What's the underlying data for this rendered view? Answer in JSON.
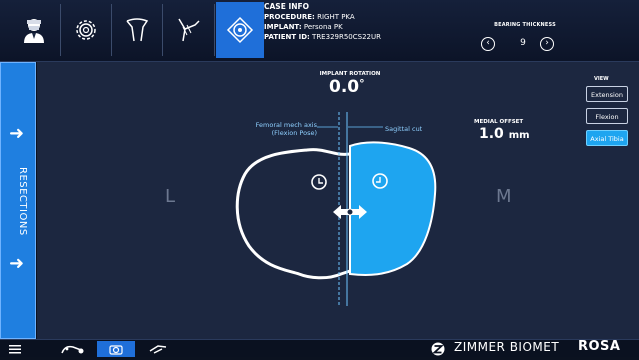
{
  "case_info": {
    "title": "CASE INFO",
    "procedure_label": "PROCEDURE:",
    "procedure_value": "RIGHT PKA",
    "implant_label": "IMPLANT:",
    "implant_value": "Persona PK",
    "patient_label": "PATIENT ID:",
    "patient_value": "TRE329R50CS22UR"
  },
  "bearing": {
    "label": "BEARING THICKNESS",
    "value": "9",
    "decrease_icon": "chevron-left-icon",
    "increase_icon": "chevron-right-icon"
  },
  "top_nav": {
    "icons": [
      "surgeon-icon",
      "gear-icon",
      "femur-icon",
      "tibia-icon",
      "knee-target-icon"
    ],
    "active_index": 4
  },
  "left_panel": {
    "label": "RESECTIONS",
    "icons": [
      "arrow-right-icon",
      "arrow-right-icon"
    ]
  },
  "main": {
    "implant_rotation_label": "IMPLANT ROTATION",
    "implant_rotation_value": "0.0",
    "implant_rotation_unit": "°",
    "femoral_axis_line1": "Femoral mech axis",
    "femoral_axis_line2": "(Flexion Pose)",
    "sagittal_cut_label": "Sagittal cut",
    "medial_offset_label": "MEDIAL OFFSET",
    "medial_offset_value": "1.0",
    "medial_offset_unit": "mm",
    "lateral_label": "L",
    "medial_label": "M"
  },
  "view": {
    "label": "VIEW",
    "buttons": [
      "Extension",
      "Flexion",
      "Axial Tibia"
    ],
    "active_index": 2
  },
  "bottom_bar": {
    "icons": [
      "menu-icon",
      "robot-arm-icon",
      "camera-icon",
      "hand-icon"
    ],
    "active_index": 2,
    "brand": "ZIMMER BIOMET",
    "product": "ROSA"
  },
  "colors": {
    "accent": "#1f6fd9",
    "implant": "#1ea5f0",
    "panel": "#1f7fe0",
    "background": "#1c2740"
  }
}
